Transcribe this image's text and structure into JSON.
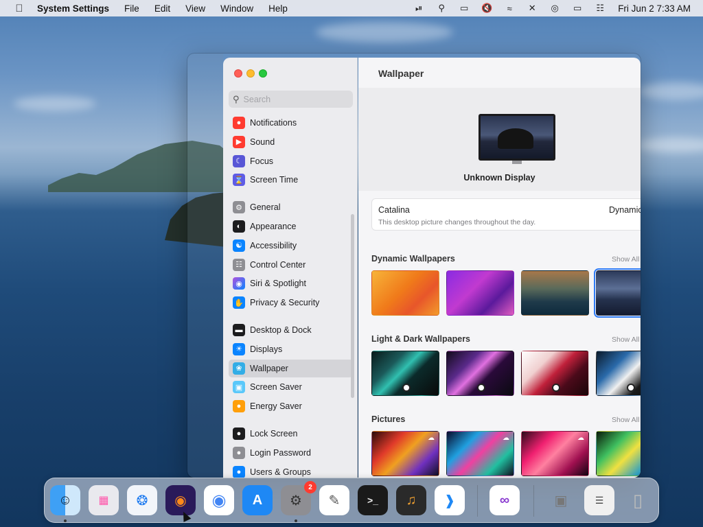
{
  "menubar": {
    "app_name": "System Settings",
    "menus": [
      "File",
      "Edit",
      "View",
      "Window",
      "Help"
    ],
    "clock": "Fri Jun 2  7:33 AM",
    "status_icons": [
      "play-circle-icon",
      "search-icon",
      "screen-mirror-icon",
      "mute-icon",
      "wifi-icon",
      "bluetooth-off-icon",
      "airdrop-icon",
      "display-icon",
      "control-center-icon"
    ]
  },
  "search": {
    "placeholder": "Search"
  },
  "sidebar": {
    "items": [
      {
        "label": "Notifications",
        "color": "#ff3b30",
        "icon": "bell-icon"
      },
      {
        "label": "Sound",
        "color": "#ff3b30",
        "icon": "speaker-icon"
      },
      {
        "label": "Focus",
        "color": "#5856d6",
        "icon": "moon-icon"
      },
      {
        "label": "Screen Time",
        "color": "#5e5ce6",
        "icon": "hourglass-icon"
      },
      {
        "label": "General",
        "color": "#8e8e93",
        "icon": "gear-icon"
      },
      {
        "label": "Appearance",
        "color": "#1c1c1e",
        "icon": "appearance-icon"
      },
      {
        "label": "Accessibility",
        "color": "#0a84ff",
        "icon": "accessibility-icon"
      },
      {
        "label": "Control Center",
        "color": "#8e8e93",
        "icon": "control-center-icon"
      },
      {
        "label": "Siri & Spotlight",
        "color": "#af52de",
        "icon": "siri-icon"
      },
      {
        "label": "Privacy & Security",
        "color": "#0a84ff",
        "icon": "hand-icon"
      },
      {
        "label": "Desktop & Dock",
        "color": "#1c1c1e",
        "icon": "dock-icon"
      },
      {
        "label": "Displays",
        "color": "#0a84ff",
        "icon": "sun-icon"
      },
      {
        "label": "Wallpaper",
        "color": "#32ade6",
        "icon": "flower-icon"
      },
      {
        "label": "Screen Saver",
        "color": "#5ac8fa",
        "icon": "screen-saver-icon"
      },
      {
        "label": "Energy Saver",
        "color": "#ff9f0a",
        "icon": "battery-icon"
      },
      {
        "label": "Lock Screen",
        "color": "#1c1c1e",
        "icon": "lock-icon"
      },
      {
        "label": "Login Password",
        "color": "#8e8e93",
        "icon": "lock-icon"
      },
      {
        "label": "Users & Groups",
        "color": "#0a84ff",
        "icon": "users-icon"
      }
    ],
    "active": "Wallpaper"
  },
  "content": {
    "title": "Wallpaper",
    "display_name": "Unknown Display",
    "current": {
      "name": "Catalina",
      "description": "This desktop picture changes throughout the day.",
      "mode": "Dynamic"
    },
    "sections": [
      {
        "title": "Dynamic Wallpapers",
        "show_all": "Show All"
      },
      {
        "title": "Light & Dark Wallpapers",
        "show_all": "Show All"
      },
      {
        "title": "Pictures",
        "show_all": "Show All"
      }
    ]
  },
  "dock": {
    "apps": [
      "Finder",
      "Launchpad",
      "Safari",
      "Firefox",
      "Chrome",
      "App Store",
      "System Settings",
      "TextEdit",
      "Terminal",
      "GarageBand",
      "Visual Studio Code",
      "Visual Studio",
      "Preview",
      "Activity",
      "Trash"
    ],
    "settings_badge": "2"
  }
}
